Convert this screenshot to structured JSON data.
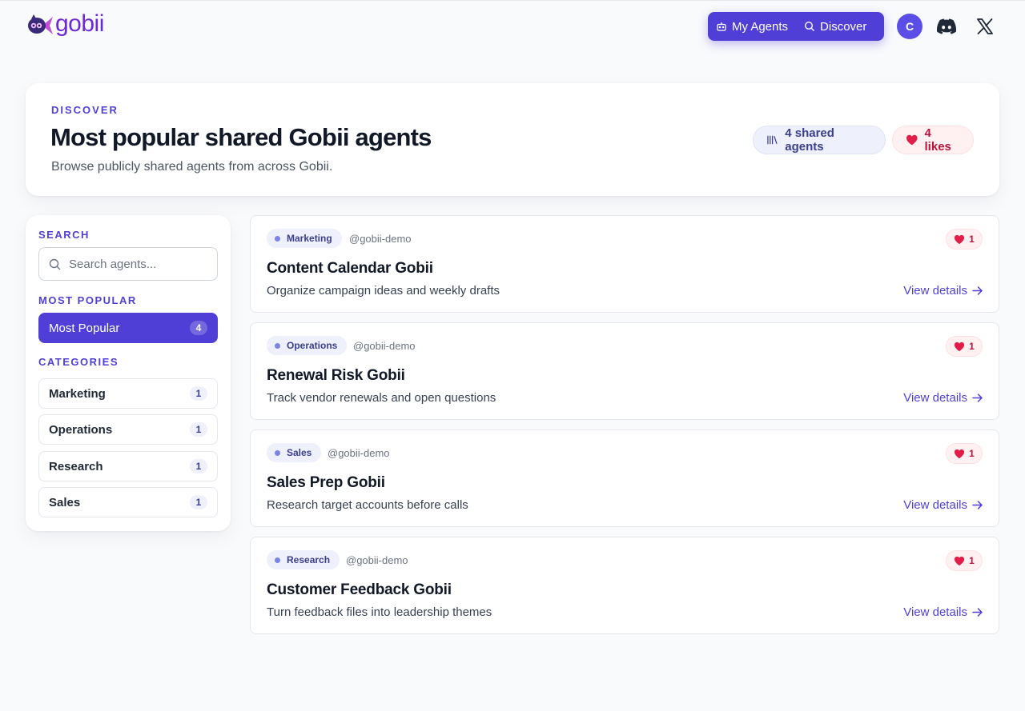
{
  "brand": {
    "name": "gobii"
  },
  "nav": {
    "my_agents": "My Agents",
    "discover": "Discover"
  },
  "user": {
    "initial": "C"
  },
  "hero": {
    "eyebrow": "DISCOVER",
    "title": "Most popular shared Gobii agents",
    "subtitle": "Browse publicly shared agents from across Gobii.",
    "shared_agents": "4 shared agents",
    "likes": "4 likes"
  },
  "sidebar": {
    "search_label": "SEARCH",
    "search_placeholder": "Search agents...",
    "search_value": "",
    "popular_label": "MOST POPULAR",
    "popular_item": {
      "label": "Most Popular",
      "count": "4"
    },
    "categories_label": "CATEGORIES",
    "categories": [
      {
        "label": "Marketing",
        "count": "1"
      },
      {
        "label": "Operations",
        "count": "1"
      },
      {
        "label": "Research",
        "count": "1"
      },
      {
        "label": "Sales",
        "count": "1"
      }
    ]
  },
  "agents": [
    {
      "category": "Marketing",
      "owner": "@gobii-demo",
      "likes": "1",
      "title": "Content Calendar Gobii",
      "description": "Organize campaign ideas and weekly drafts",
      "link": "View details"
    },
    {
      "category": "Operations",
      "owner": "@gobii-demo",
      "likes": "1",
      "title": "Renewal Risk Gobii",
      "description": "Track vendor renewals and open questions",
      "link": "View details"
    },
    {
      "category": "Sales",
      "owner": "@gobii-demo",
      "likes": "1",
      "title": "Sales Prep Gobii",
      "description": "Research target accounts before calls",
      "link": "View details"
    },
    {
      "category": "Research",
      "owner": "@gobii-demo",
      "likes": "1",
      "title": "Customer Feedback Gobii",
      "description": "Turn feedback files into leadership themes",
      "link": "View details"
    }
  ],
  "colors": {
    "accent": "#4f3fd6",
    "like": "#e11d48",
    "brand": "#6d28d9"
  }
}
